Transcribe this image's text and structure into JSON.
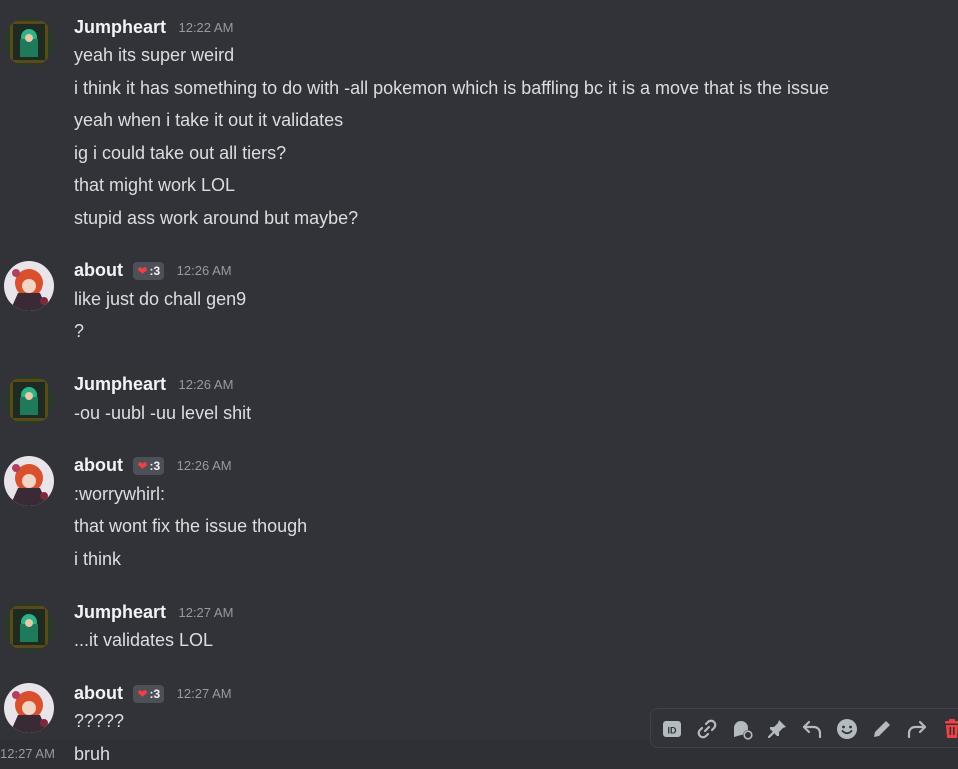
{
  "colors": {
    "background": "#313338",
    "username": "#f2f3f5",
    "text": "#dbdee1",
    "timestamp": "#949ba4",
    "danger": "#f23f43"
  },
  "messages": [
    {
      "author": "Jumpheart",
      "time": "12:22 AM",
      "lines": [
        "yeah its super weird",
        "i think it has something to do with -all pokemon which is baffling bc it is a move that is the issue",
        "yeah when i take it out it validates",
        "ig i could take out all tiers?",
        "that might work LOL",
        "stupid ass work around but maybe?"
      ]
    },
    {
      "author": "about",
      "badge": ":3",
      "time": "12:26 AM",
      "lines": [
        "like just do chall gen9",
        "?"
      ]
    },
    {
      "author": "Jumpheart",
      "time": "12:26 AM",
      "lines": [
        "-ou -uubl -uu level shit"
      ]
    },
    {
      "author": "about",
      "badge": ":3",
      "time": "12:26 AM",
      "lines": [
        ":worrywhirl:",
        "that wont fix the issue though",
        "i think"
      ]
    },
    {
      "author": "Jumpheart",
      "time": "12:27 AM",
      "lines": [
        "...it validates LOL"
      ]
    },
    {
      "author": "about",
      "badge": ":3",
      "time": "12:27 AM",
      "lines": [
        "?????"
      ]
    }
  ],
  "hovered_message": {
    "time": "12:27 AM",
    "text": "bruh"
  },
  "toolbar_icons": [
    "id-icon",
    "link-icon",
    "thread-icon",
    "pin-icon",
    "reply-icon",
    "emoji-icon",
    "edit-icon",
    "forward-icon",
    "delete-icon"
  ]
}
